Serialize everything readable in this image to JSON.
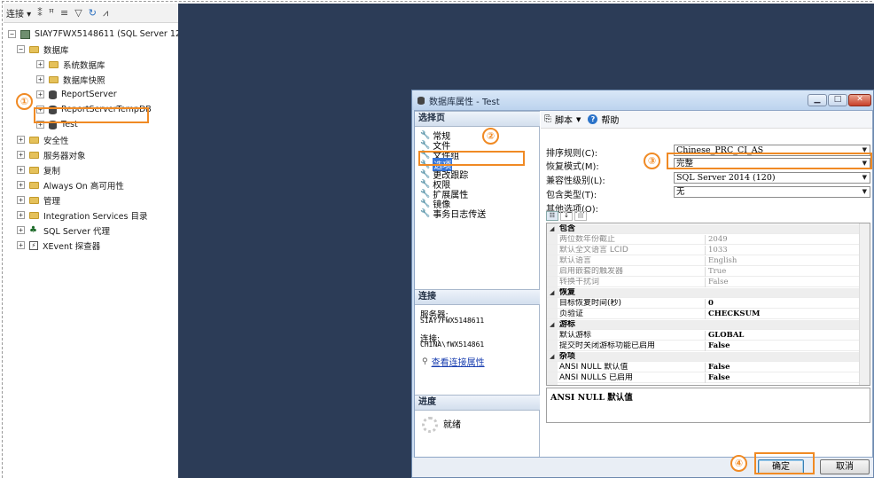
{
  "toolbar": {
    "connect_label": "连接 ▾",
    "glyphs": [
      "⁑",
      "ꟸ",
      "≡",
      "▽",
      "↻",
      "⩘"
    ]
  },
  "tree": {
    "root": "SIAY7FWX5148611 (SQL Server 12.0",
    "databases": "数据库",
    "system_dbs": "系统数据库",
    "snapshots": "数据库快照",
    "report_server": "ReportServer",
    "report_server_temp": "ReportServerTempDB",
    "test_db": "Test",
    "security": "安全性",
    "server_objects": "服务器对象",
    "replication": "复制",
    "always_on": "Always On 高可用性",
    "management": "管理",
    "integration": "Integration Services 目录",
    "agent": "SQL Server 代理",
    "xevent": "XEvent 探查器"
  },
  "dialog": {
    "title": "数据库属性 - Test",
    "select_page_header": "选择页",
    "pages": [
      "常规",
      "文件",
      "文件组",
      "选项",
      "更改跟踪",
      "权限",
      "扩展属性",
      "镜像",
      "事务日志传送"
    ],
    "selected_page_index": 3,
    "connection_header": "连接",
    "server_label": "服务器:",
    "server_value": "SIAY7FWX5148611",
    "connection_label": "连接:",
    "connection_value": "CHINA\\fWX514861",
    "view_conn_link": "查看连接属性",
    "progress_header": "进度",
    "progress_status": "就绪",
    "script_label": "脚本",
    "help_label": "帮助",
    "collation_label": "排序规则(C):",
    "collation_value": "Chinese_PRC_CI_AS",
    "recovery_label": "恢复模式(M):",
    "recovery_value": "完整",
    "compat_label": "兼容性级别(L):",
    "compat_value": "SQL Server 2014 (120)",
    "containment_label": "包含类型(T):",
    "containment_value": "无",
    "other_options_label": "其他选项(O):",
    "grid": [
      {
        "type": "cat",
        "name": "包含"
      },
      {
        "type": "dis",
        "name": "两位数年份截止",
        "value": "2049"
      },
      {
        "type": "dis",
        "name": "默认全文语言 LCID",
        "value": "1033"
      },
      {
        "type": "dis",
        "name": "默认语言",
        "value": "English"
      },
      {
        "type": "dis",
        "name": "启用嵌套的触发器",
        "value": "True"
      },
      {
        "type": "dis",
        "name": "转换干扰词",
        "value": "False"
      },
      {
        "type": "cat",
        "name": "恢复"
      },
      {
        "type": "en",
        "name": "目标恢复时间(秒)",
        "value": "0"
      },
      {
        "type": "en",
        "name": "页验证",
        "value": "CHECKSUM"
      },
      {
        "type": "cat",
        "name": "游标"
      },
      {
        "type": "en",
        "name": "默认游标",
        "value": "GLOBAL"
      },
      {
        "type": "en",
        "name": "提交时关闭游标功能已启用",
        "value": "False"
      },
      {
        "type": "cat",
        "name": "杂项"
      },
      {
        "type": "en",
        "name": "ANSI NULL 默认值",
        "value": "False"
      },
      {
        "type": "en",
        "name": "ANSI NULLS 已启用",
        "value": "False"
      }
    ],
    "description": "ANSI NULL 默认值",
    "ok_label": "确定",
    "cancel_label": "取消"
  },
  "annotations": [
    "①",
    "②",
    "③",
    "④"
  ],
  "colors": {
    "dark_bg": "#2c3c57",
    "annotation": "#f08a24",
    "selection": "#3875d7"
  }
}
